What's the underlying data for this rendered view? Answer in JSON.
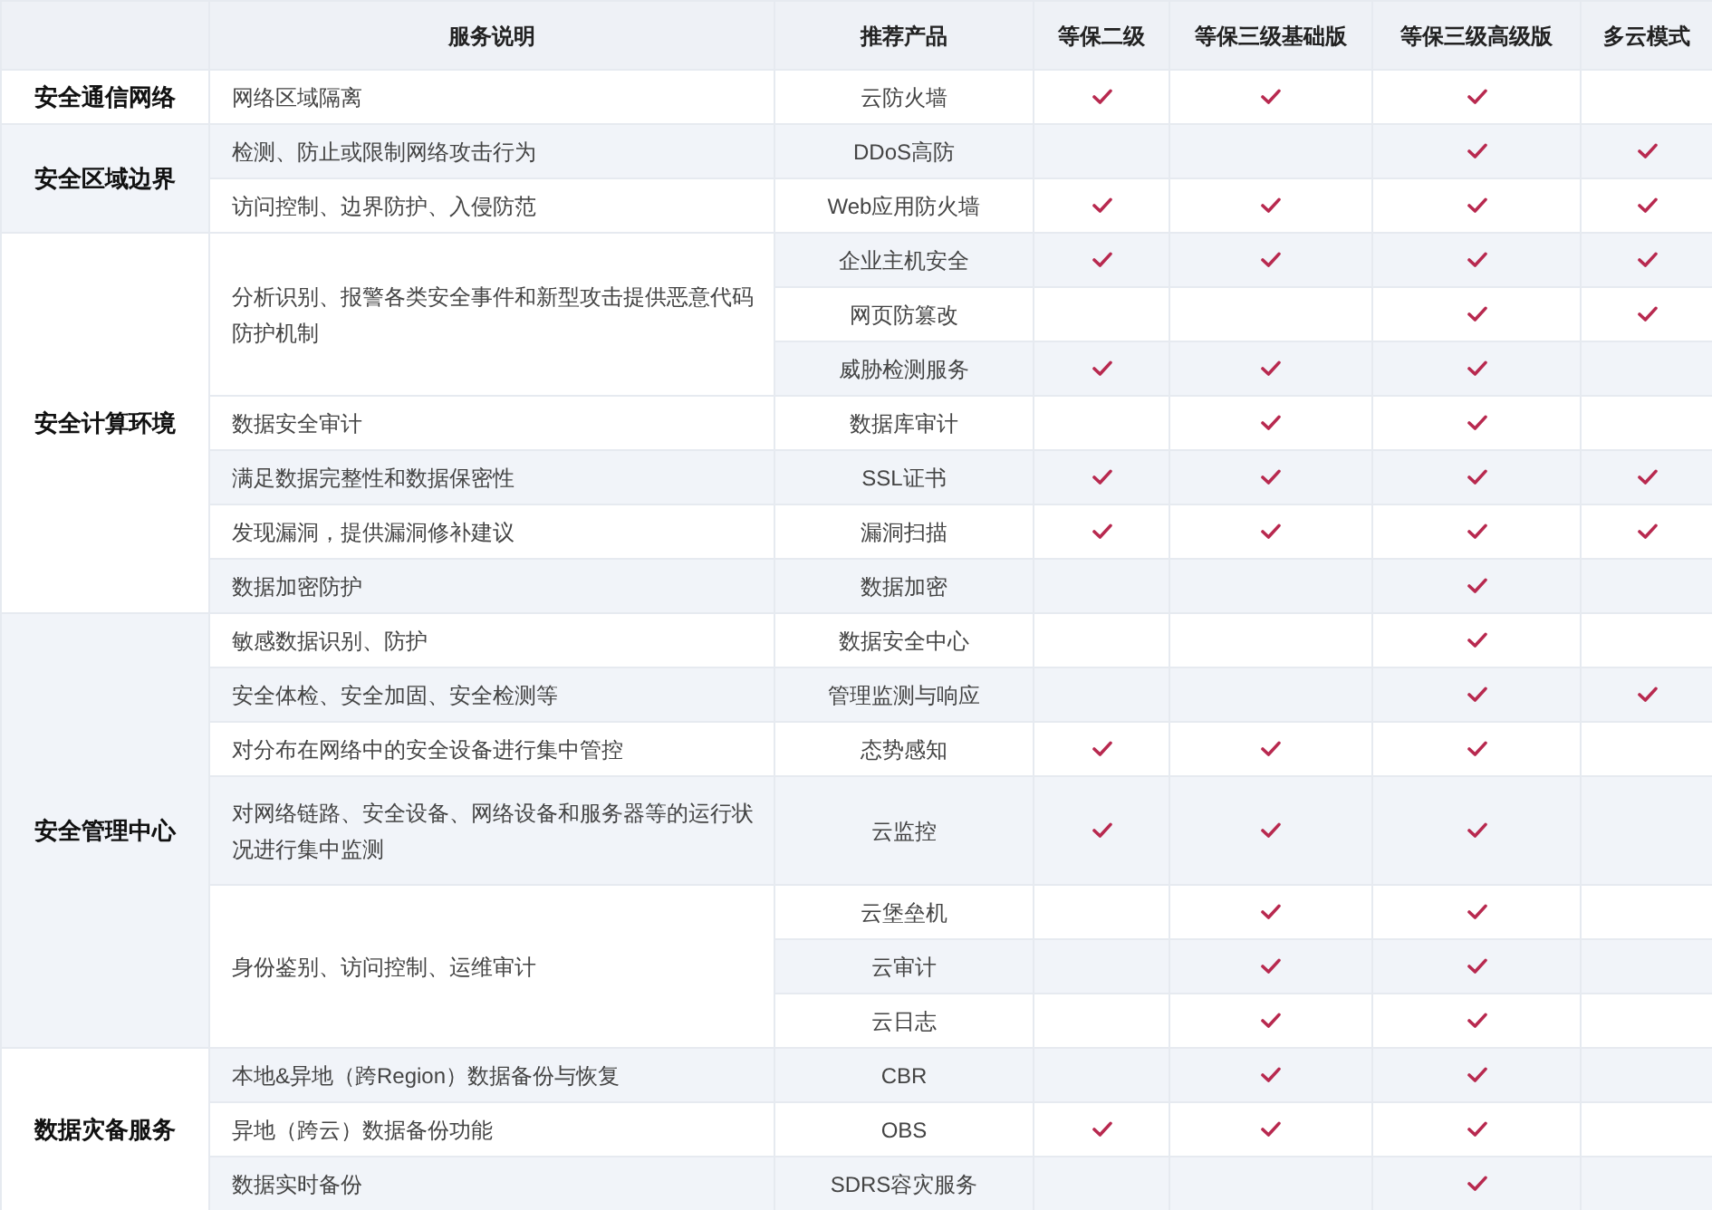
{
  "table": {
    "columns": [
      "服务说明",
      "推荐产品",
      "等保二级",
      "等保三级基础版",
      "等保三级高级版",
      "多云模式"
    ],
    "groups": [
      {
        "category": "安全通信网络",
        "items": [
          {
            "description": "网络区域隔离",
            "products": [
              {
                "name": "云防火墙",
                "checks": [
                  true,
                  true,
                  true,
                  false
                ]
              }
            ]
          }
        ]
      },
      {
        "category": "安全区域边界",
        "items": [
          {
            "description": "检测、防止或限制网络攻击行为",
            "products": [
              {
                "name": "DDoS高防",
                "checks": [
                  false,
                  false,
                  true,
                  true
                ]
              }
            ]
          },
          {
            "description": "访问控制、边界防护、入侵防范",
            "products": [
              {
                "name": "Web应用防火墙",
                "checks": [
                  true,
                  true,
                  true,
                  true
                ]
              }
            ]
          }
        ]
      },
      {
        "category": "安全计算环境",
        "items": [
          {
            "description": "分析识别、报警各类安全事件和新型攻击提供恶意代码防护机制",
            "products": [
              {
                "name": "企业主机安全",
                "checks": [
                  true,
                  true,
                  true,
                  true
                ]
              },
              {
                "name": "网页防篡改",
                "checks": [
                  false,
                  false,
                  true,
                  true
                ]
              },
              {
                "name": "威胁检测服务",
                "checks": [
                  true,
                  true,
                  true,
                  false
                ]
              }
            ]
          },
          {
            "description": "数据安全审计",
            "products": [
              {
                "name": "数据库审计",
                "checks": [
                  false,
                  true,
                  true,
                  false
                ]
              }
            ]
          },
          {
            "description": "满足数据完整性和数据保密性",
            "products": [
              {
                "name": "SSL证书",
                "checks": [
                  true,
                  true,
                  true,
                  true
                ]
              }
            ]
          },
          {
            "description": "发现漏洞，提供漏洞修补建议",
            "products": [
              {
                "name": "漏洞扫描",
                "checks": [
                  true,
                  true,
                  true,
                  true
                ]
              }
            ]
          },
          {
            "description": "数据加密防护",
            "products": [
              {
                "name": "数据加密",
                "checks": [
                  false,
                  false,
                  true,
                  false
                ]
              }
            ]
          }
        ]
      },
      {
        "category": "安全管理中心",
        "items": [
          {
            "description": "敏感数据识别、防护",
            "products": [
              {
                "name": "数据安全中心",
                "checks": [
                  false,
                  false,
                  true,
                  false
                ]
              }
            ]
          },
          {
            "description": "安全体检、安全加固、安全检测等",
            "products": [
              {
                "name": "管理监测与响应",
                "checks": [
                  false,
                  false,
                  true,
                  true
                ]
              }
            ]
          },
          {
            "description": "对分布在网络中的安全设备进行集中管控",
            "products": [
              {
                "name": "态势感知",
                "checks": [
                  true,
                  true,
                  true,
                  false
                ]
              }
            ]
          },
          {
            "description": "对网络链路、安全设备、网络设备和服务器等的运行状况进行集中监测",
            "products": [
              {
                "name": "云监控",
                "checks": [
                  true,
                  true,
                  true,
                  false
                ]
              }
            ]
          },
          {
            "description": "身份鉴别、访问控制、运维审计",
            "products": [
              {
                "name": "云堡垒机",
                "checks": [
                  false,
                  true,
                  true,
                  false
                ]
              },
              {
                "name": "云审计",
                "checks": [
                  false,
                  true,
                  true,
                  false
                ]
              },
              {
                "name": "云日志",
                "checks": [
                  false,
                  true,
                  true,
                  false
                ]
              }
            ]
          }
        ]
      },
      {
        "category": "数据灾备服务",
        "items": [
          {
            "description": "本地&异地（跨Region）数据备份与恢复",
            "products": [
              {
                "name": "CBR",
                "checks": [
                  false,
                  true,
                  true,
                  false
                ]
              }
            ]
          },
          {
            "description": "异地（跨云）数据备份功能",
            "products": [
              {
                "name": "OBS",
                "checks": [
                  true,
                  true,
                  true,
                  false
                ]
              }
            ]
          },
          {
            "description": "数据实时备份",
            "products": [
              {
                "name": "SDRS容灾服务",
                "checks": [
                  false,
                  false,
                  true,
                  false
                ]
              }
            ]
          }
        ]
      }
    ]
  }
}
